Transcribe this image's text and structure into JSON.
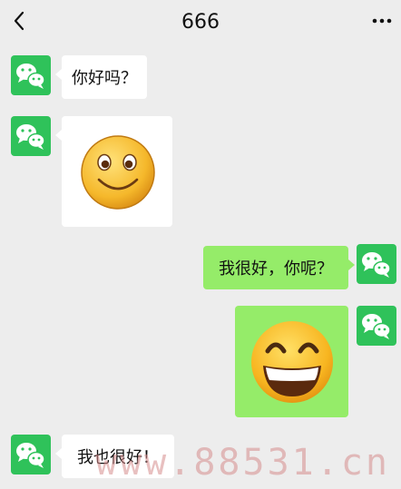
{
  "header": {
    "title": "666",
    "back_icon": "chevron-left-icon",
    "more_icon": "more-dots-icon"
  },
  "avatar_icon": "wechat-logo-icon",
  "colors": {
    "background": "#ededed",
    "incoming_bubble": "#ffffff",
    "outgoing_bubble": "#95ec69",
    "avatar": "#2fc25a"
  },
  "messages": [
    {
      "side": "incoming",
      "type": "text",
      "text": "你好吗？"
    },
    {
      "side": "incoming",
      "type": "sticker",
      "sticker": "smile-emoji-icon"
    },
    {
      "side": "outgoing",
      "type": "text",
      "text": "我很好，你呢？"
    },
    {
      "side": "outgoing",
      "type": "sticker",
      "sticker": "grin-emoji-icon"
    },
    {
      "side": "incoming",
      "type": "text",
      "text": "我也很好！"
    }
  ],
  "watermark": "www.88531.cn"
}
